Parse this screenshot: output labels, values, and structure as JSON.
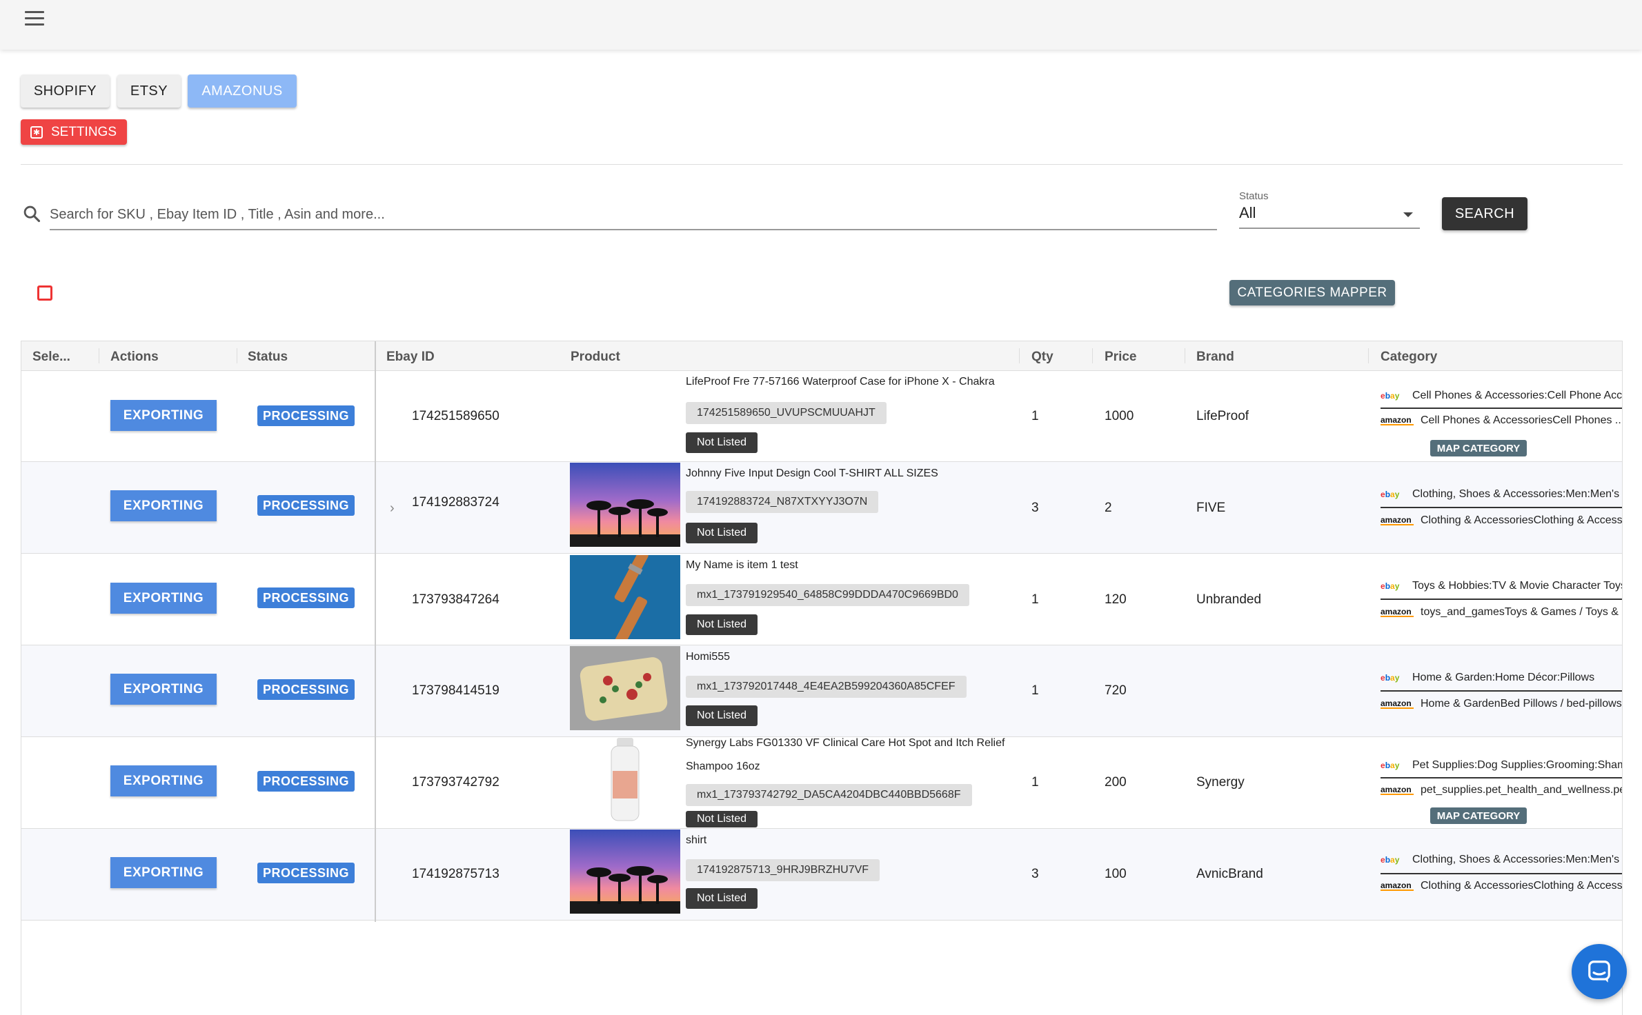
{
  "app": {
    "menu_icon": "hamburger-menu-icon"
  },
  "tabs": [
    {
      "label": "SHOPIFY",
      "active": false
    },
    {
      "label": "ETSY",
      "active": false
    },
    {
      "label": "AMAZONUS",
      "active": true
    }
  ],
  "settings": {
    "label": "SETTINGS",
    "icon": "gear-icon"
  },
  "search": {
    "placeholder": "Search for SKU , Ebay Item ID , Title , Asin and more...",
    "value": "",
    "button_label": "SEARCH"
  },
  "status_filter": {
    "label": "Status",
    "selected": "All"
  },
  "categories_mapper": {
    "label": "CATEGORIES MAPPER"
  },
  "colors": {
    "accent": "#4f8ae0",
    "danger": "#ef4444",
    "dark": "#333333",
    "mapper": "#546e7a"
  },
  "table": {
    "headers": {
      "select": "Sele...",
      "actions": "Actions",
      "status": "Status",
      "ebay_id": "Ebay ID",
      "product": "Product",
      "qty": "Qty",
      "price": "Price",
      "brand": "Brand",
      "category": "Category"
    },
    "rows": [
      {
        "action": "EXPORTING",
        "status": "PROCESSING",
        "ebay_id": "174251589650",
        "title": "LifeProof Fre 77-57166 Waterproof Case for iPhone X - Chakra",
        "sku": "174251589650_UVUPSCMUUAHJT",
        "listing": "Not Listed",
        "qty": "1",
        "price": "1000",
        "brand": "LifeProof",
        "ebay_category": "Cell Phones & Accessories:Cell Phone Accessories",
        "amazon_category": "Cell Phones & AccessoriesCell Phones ...",
        "map_button": "MAP CATEGORY"
      },
      {
        "action": "EXPORTING",
        "status": "PROCESSING",
        "ebay_id": "174192883724",
        "title": "Johnny Five Input Design Cool T-SHIRT ALL SIZES",
        "sku": "174192883724_N87XTXYYJ3O7N",
        "listing": "Not Listed",
        "qty": "3",
        "price": "2",
        "brand": "FIVE",
        "ebay_category": "Clothing, Shoes & Accessories:Men:Men's",
        "amazon_category": "Clothing & AccessoriesClothing & Accessories"
      },
      {
        "action": "EXPORTING",
        "status": "PROCESSING",
        "ebay_id": "173793847264",
        "title": "My Name is item 1 test",
        "sku": "mx1_173791929540_64858C99DDDA470C9669BD0",
        "listing": "Not Listed",
        "qty": "1",
        "price": "120",
        "brand": "Unbranded",
        "ebay_category": "Toys & Hobbies:TV & Movie Character Toys",
        "amazon_category": "toys_and_gamesToys & Games / Toys &"
      },
      {
        "action": "EXPORTING",
        "status": "PROCESSING",
        "ebay_id": "173798414519",
        "title": "Homi555",
        "sku": "mx1_173792017448_4E4EA2B599204360A85CFEF",
        "listing": "Not Listed",
        "qty": "1",
        "price": "720",
        "brand": "",
        "ebay_category": "Home & Garden:Home Décor:Pillows",
        "amazon_category": "Home & GardenBed Pillows / bed-pillows"
      },
      {
        "action": "EXPORTING",
        "status": "PROCESSING",
        "ebay_id": "173793742792",
        "title": "Synergy Labs FG01330 VF Clinical Care Hot Spot and Itch Relief Shampoo 16oz",
        "sku": "mx1_173793742792_DA5CA4204DBC440BBD5668F",
        "listing": "Not Listed",
        "qty": "1",
        "price": "200",
        "brand": "Synergy",
        "ebay_category": "Pet Supplies:Dog Supplies:Grooming:Shampoo",
        "amazon_category": "pet_supplies.pet_health_and_wellness.pet",
        "map_button": "MAP CATEGORY"
      },
      {
        "action": "EXPORTING",
        "status": "PROCESSING",
        "ebay_id": "174192875713",
        "title": "shirt",
        "sku": "174192875713_9HRJ9BRZHU7VF",
        "listing": "Not Listed",
        "qty": "3",
        "price": "100",
        "brand": "AvnicBrand",
        "ebay_category": "Clothing, Shoes & Accessories:Men:Men's",
        "amazon_category": "Clothing & AccessoriesClothing & Accessories"
      }
    ]
  },
  "logos": {
    "ebay": [
      "e",
      "b",
      "a",
      "y"
    ],
    "amazon": "amazon"
  },
  "chat": {
    "icon": "chat-bubble-icon"
  }
}
